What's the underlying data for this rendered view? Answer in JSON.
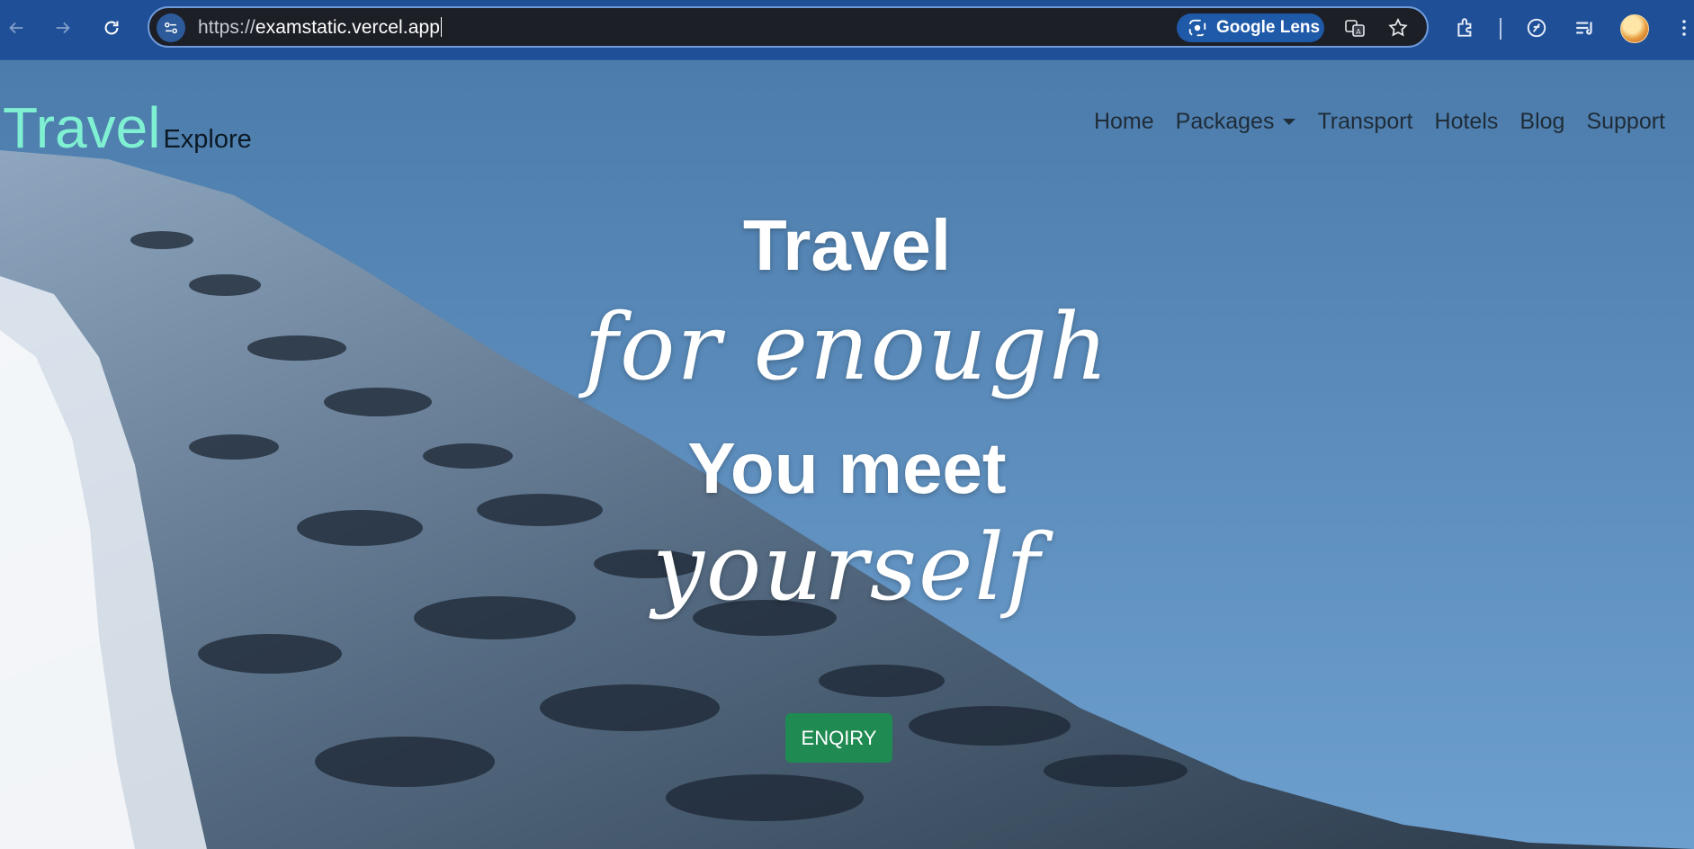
{
  "browser": {
    "url_scheme": "https://",
    "url_host": "examstatic.vercel.app",
    "lens_label": "Google Lens",
    "icons": [
      "back-icon",
      "forward-icon",
      "reload-icon",
      "site-info-icon",
      "google-lens-icon",
      "translate-icon",
      "bookmark-star-icon",
      "extensions-icon",
      "performance-icon",
      "reading-list-icon",
      "profile-avatar"
    ]
  },
  "site": {
    "brand_main": "Travel",
    "brand_sub": "Explore",
    "brand_color": "#7ff0d2",
    "nav": [
      {
        "label": "Home"
      },
      {
        "label": "Packages",
        "dropdown": true
      },
      {
        "label": "Transport"
      },
      {
        "label": "Hotels"
      },
      {
        "label": "Blog"
      },
      {
        "label": "Support"
      }
    ]
  },
  "hero": {
    "line1": "Travel",
    "line2": "for enough",
    "line3": "You meet",
    "line4": "yourself",
    "cta_label": "ENQIRY",
    "cta_color": "#1f8a52"
  }
}
